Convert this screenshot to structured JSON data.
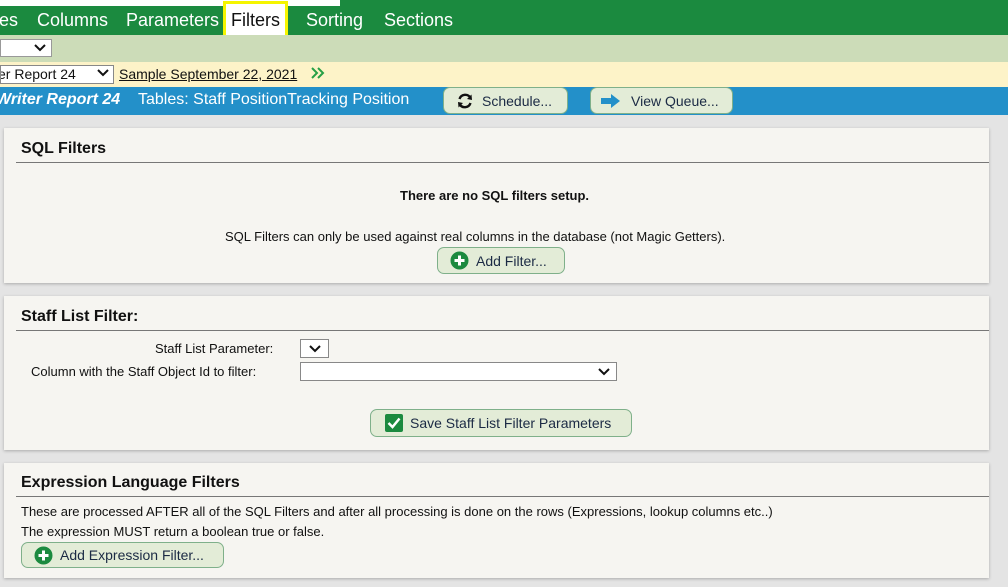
{
  "nav": {
    "tabs": [
      {
        "label": "es"
      },
      {
        "label": "Columns"
      },
      {
        "label": "Parameters"
      },
      {
        "label": "Filters"
      },
      {
        "label": "Sorting"
      },
      {
        "label": "Sections"
      }
    ],
    "active_tab": "Filters"
  },
  "report_bar": {
    "report_select_value": "er Report 24",
    "sample_link": "Sample September 22, 2021"
  },
  "title_bar": {
    "report_title": "Writer Report 24",
    "tables": "Tables: Staff PositionTracking Position",
    "schedule_label": "Schedule...",
    "view_queue_label": "View Queue..."
  },
  "sql_filters": {
    "heading": "SQL Filters",
    "empty_message": "There are no SQL filters setup.",
    "note": "SQL Filters can only be used against real columns in the database (not Magic Getters).",
    "add_label": "Add Filter..."
  },
  "staff_list_filter": {
    "heading": "Staff List Filter:",
    "parameter_label": "Staff List Parameter:",
    "column_label": "Column with the Staff Object Id to filter:",
    "save_label": "Save Staff List Filter Parameters"
  },
  "expression_filters": {
    "heading": "Expression Language Filters",
    "line1": "These are processed AFTER all of the SQL Filters and after all processing is done on the rows (Expressions, lookup columns etc..)",
    "line2": "The expression MUST return a boolean true or false.",
    "add_label": "Add Expression Filter..."
  },
  "colors": {
    "nav_green": "#1b8a3f",
    "title_blue": "#2390c9",
    "highlight_yellow": "#f5f500",
    "button_bg": "#e3ecd7",
    "icon_green": "#1b8a3f",
    "icon_blue": "#2390c9"
  }
}
